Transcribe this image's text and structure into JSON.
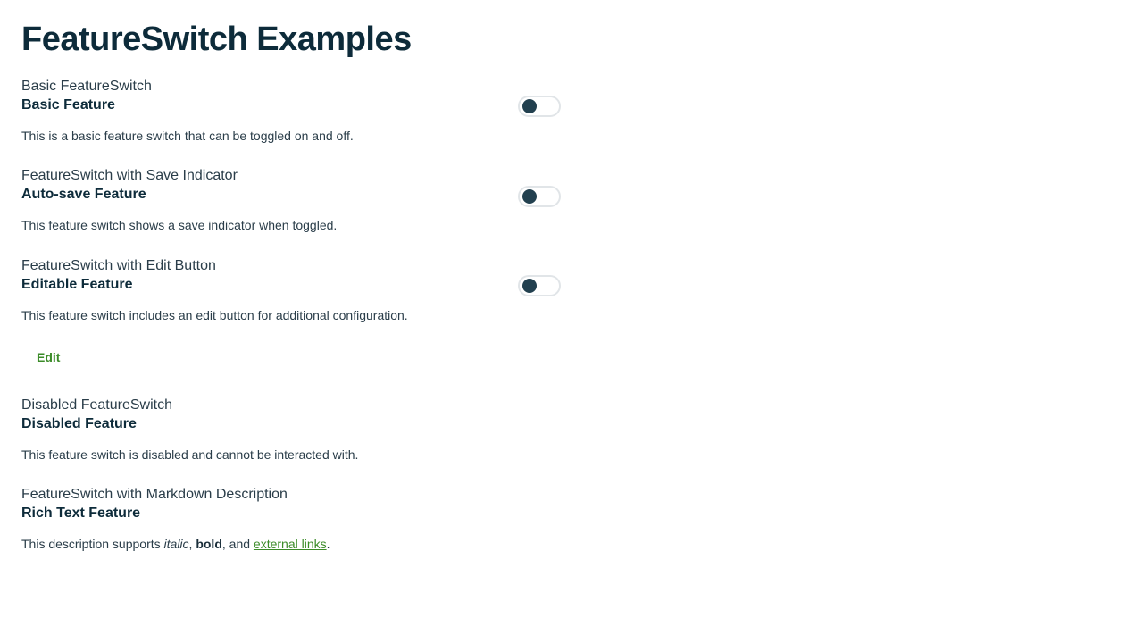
{
  "page": {
    "title": "FeatureSwitch Examples"
  },
  "sections": [
    {
      "heading": "Basic FeatureSwitch",
      "feature_title": "Basic Feature",
      "description": "This is a basic feature switch that can be toggled on and off.",
      "toggle_on": false
    },
    {
      "heading": "FeatureSwitch with Save Indicator",
      "feature_title": "Auto-save Feature",
      "description": "This feature switch shows a save indicator when toggled.",
      "toggle_on": false
    },
    {
      "heading": "FeatureSwitch with Edit Button",
      "feature_title": "Editable Feature",
      "description": "This feature switch includes an edit button for additional configuration.",
      "toggle_on": false,
      "edit_label": "Edit"
    },
    {
      "heading": "Disabled FeatureSwitch",
      "feature_title": "Disabled Feature",
      "description": "This feature switch is disabled and cannot be interacted with."
    },
    {
      "heading": "FeatureSwitch with Markdown Description",
      "feature_title": "Rich Text Feature",
      "description_parts": {
        "prefix": "This description supports ",
        "italic": "italic",
        "sep1": ", ",
        "bold": "bold",
        "sep2": ", and ",
        "link": "external links",
        "suffix": "."
      }
    }
  ],
  "colors": {
    "title": "#0d2b3a",
    "text": "#2a3d49",
    "link": "#3b8b28",
    "toggle_knob": "#22404f",
    "toggle_border": "#e1e5e8"
  }
}
